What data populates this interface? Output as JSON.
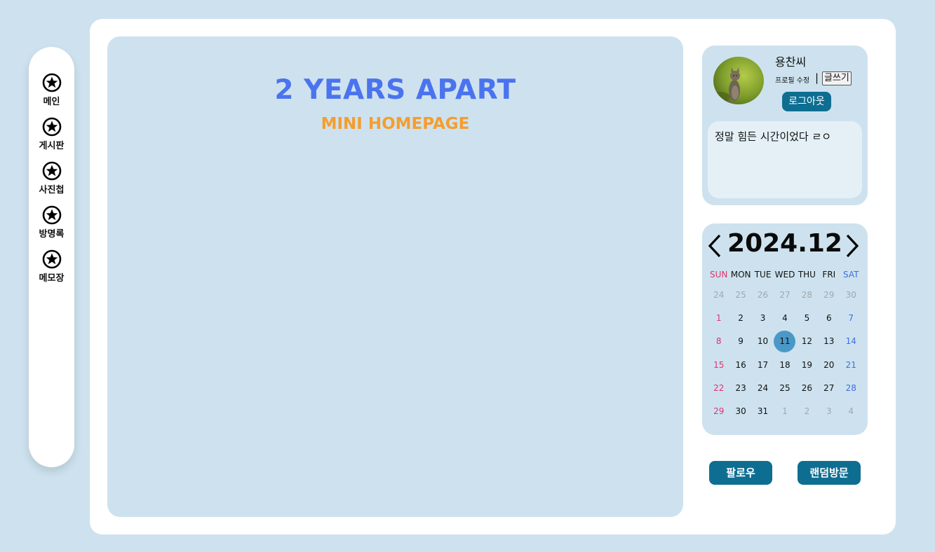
{
  "nav": {
    "items": [
      {
        "label": "메인",
        "icon": "star-icon"
      },
      {
        "label": "게시판",
        "icon": "star-icon"
      },
      {
        "label": "사진첩",
        "icon": "star-icon"
      },
      {
        "label": "방명록",
        "icon": "star-icon"
      },
      {
        "label": "메모장",
        "icon": "star-icon"
      }
    ]
  },
  "main": {
    "title": "2 YEARS APART",
    "subtitle": "MINI HOMEPAGE"
  },
  "profile": {
    "username": "용찬씨",
    "edit_label": "프로필 수정",
    "separator": "|",
    "write_label": "글쓰기",
    "logout_label": "로그아웃",
    "status_text": "정말 힘든 시간이었다 ㄹㅇ",
    "avatar": "cat-photo"
  },
  "calendar": {
    "title": "2024.12",
    "weekdays": [
      "SUN",
      "MON",
      "TUE",
      "WED",
      "THU",
      "FRI",
      "SAT"
    ],
    "weeks": [
      [
        "24",
        "25",
        "26",
        "27",
        "28",
        "29",
        "30"
      ],
      [
        "1",
        "2",
        "3",
        "4",
        "5",
        "6",
        "7"
      ],
      [
        "8",
        "9",
        "10",
        "11",
        "12",
        "13",
        "14"
      ],
      [
        "15",
        "16",
        "17",
        "18",
        "19",
        "20",
        "21"
      ],
      [
        "22",
        "23",
        "24",
        "25",
        "26",
        "27",
        "28"
      ],
      [
        "29",
        "30",
        "31",
        "1",
        "2",
        "3",
        "4"
      ]
    ],
    "today": "11"
  },
  "actions": {
    "follow_label": "팔로우",
    "random_label": "랜덤방문"
  },
  "colors": {
    "background": "#cde2ee",
    "title": "#4b73ef",
    "subtitle": "#f59d30",
    "button": "#0e6e92",
    "sunday": "#e0336e",
    "saturday": "#3f6ee6",
    "today": "#4a98c8"
  }
}
